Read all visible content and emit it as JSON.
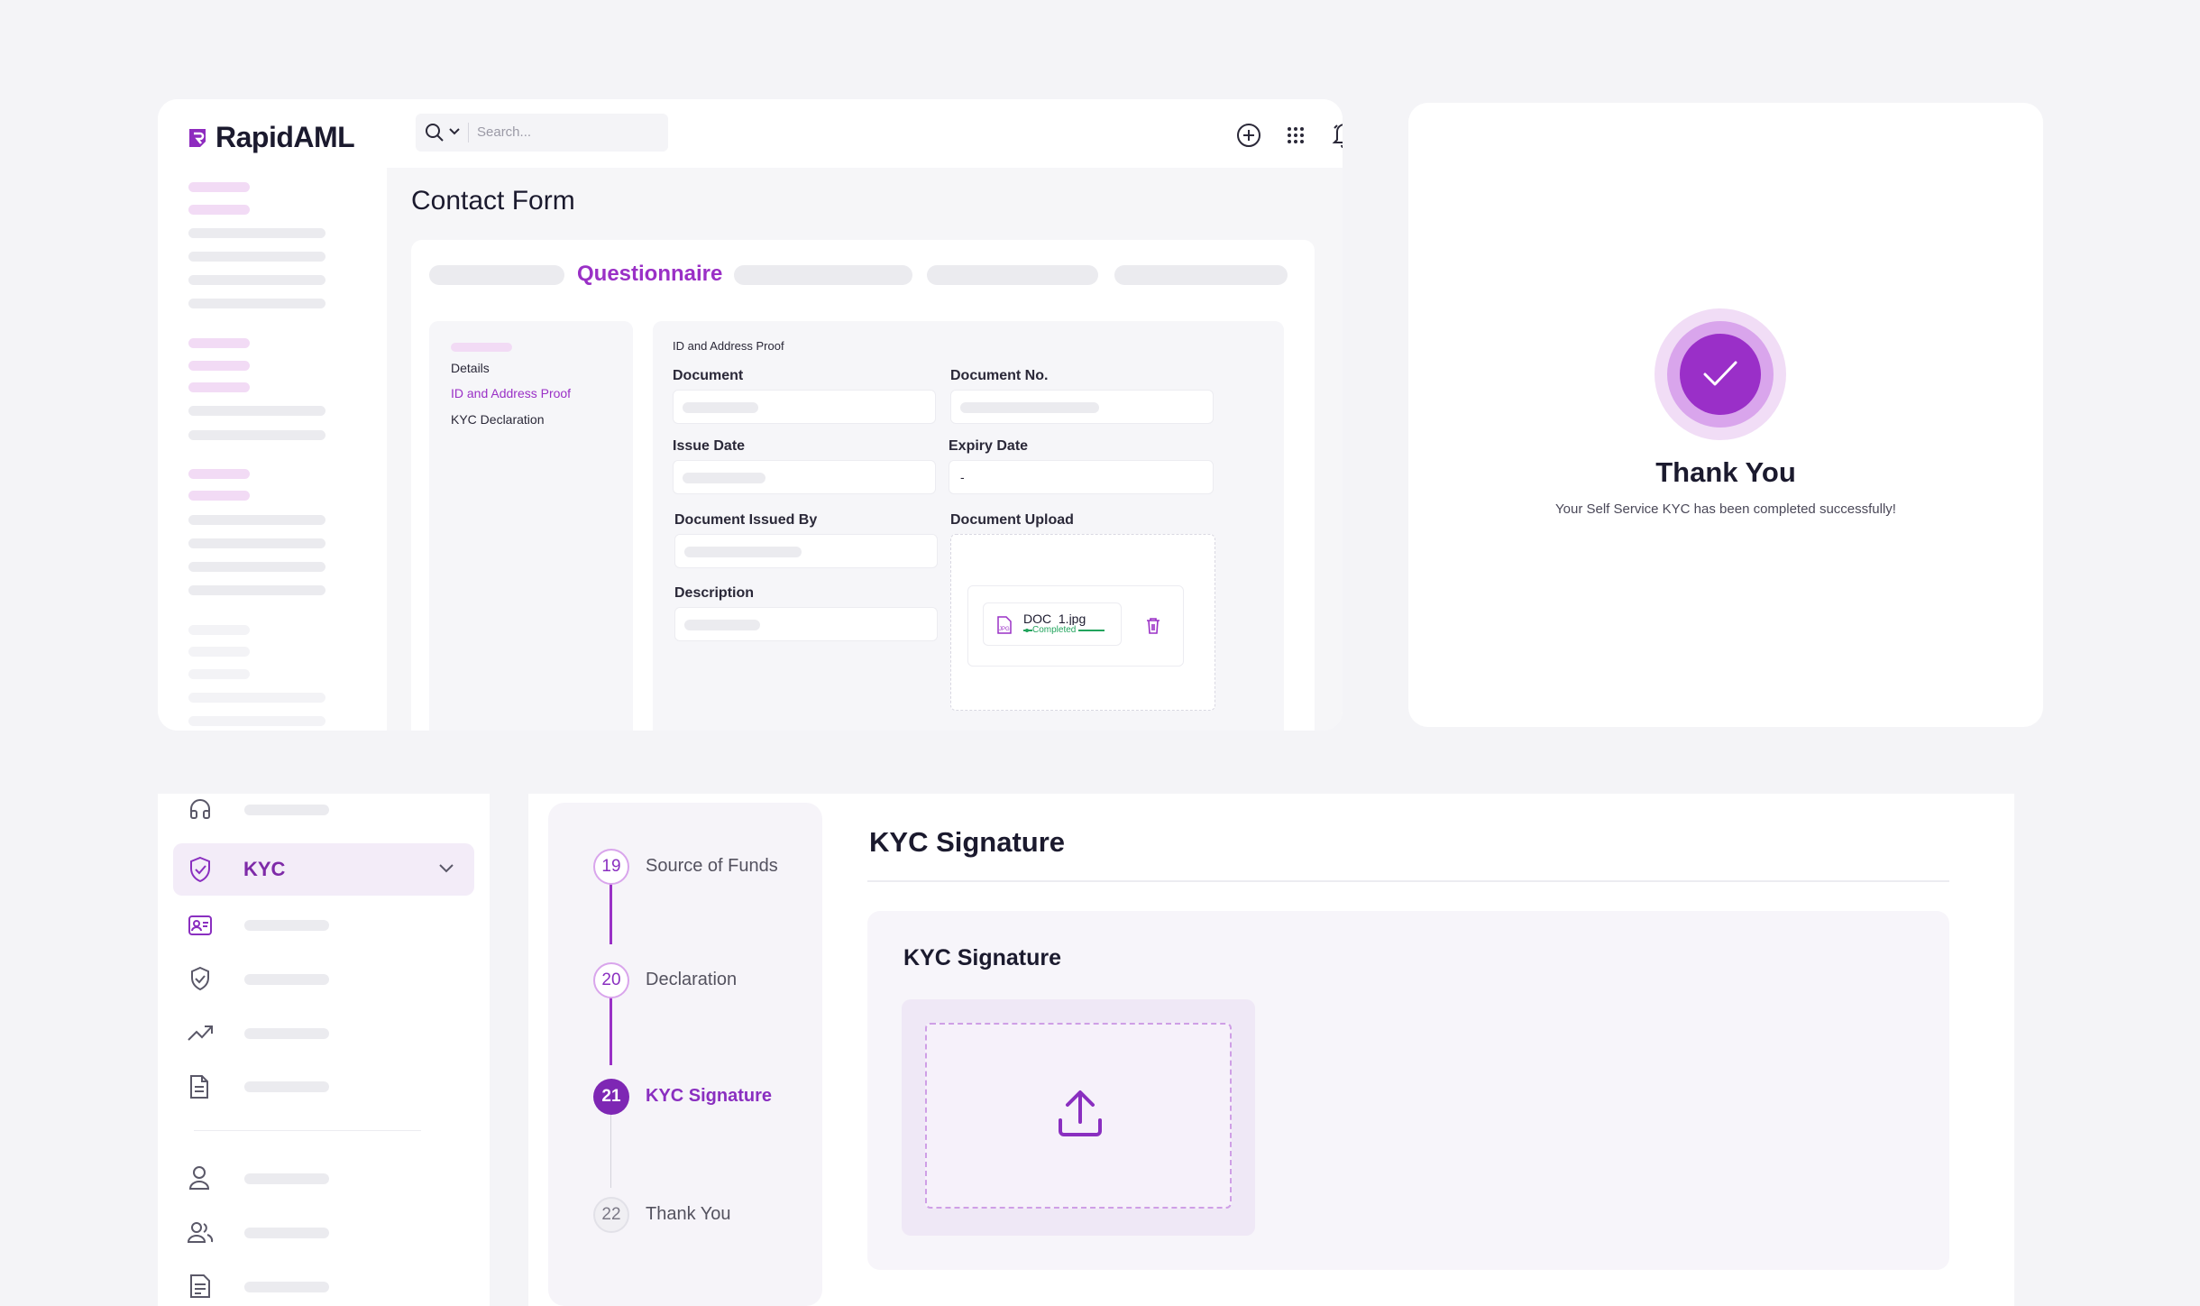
{
  "app": {
    "brand": "RapidAML",
    "search_placeholder": "Search..."
  },
  "contact_form": {
    "title": "Contact Form",
    "active_step": "Questionnaire",
    "left_nav": {
      "items": [
        {
          "label": "Details",
          "active": false
        },
        {
          "label": "ID and Address Proof",
          "active": true
        },
        {
          "label": "KYC Declaration",
          "active": false
        }
      ]
    },
    "section_title": "ID and Address Proof",
    "fields": {
      "document": "Document",
      "document_no": "Document No.",
      "issue_date": "Issue Date",
      "expiry_date": "Expiry Date",
      "expiry_value": "-",
      "issued_by": "Document Issued By",
      "document_upload": "Document Upload",
      "description": "Description"
    },
    "upload_file": {
      "name": "DOC_1.jpg",
      "status": "Completed",
      "type_label": "JPG",
      "progress": 1.0
    }
  },
  "thank_you": {
    "title": "Thank You",
    "message": "Your Self Service KYC has been completed successfully!"
  },
  "sidebar_bottom": {
    "active_item": "KYC"
  },
  "kyc_steps": [
    {
      "number": "19",
      "label": "Source of Funds",
      "state": "done"
    },
    {
      "number": "20",
      "label": "Declaration",
      "state": "done"
    },
    {
      "number": "21",
      "label": "KYC Signature",
      "state": "active"
    },
    {
      "number": "22",
      "label": "Thank You",
      "state": "pending"
    }
  ],
  "kyc_signature": {
    "title": "KYC Signature",
    "card_title": "KYC Signature"
  },
  "colors": {
    "accent": "#9a30c6",
    "accent_dark": "#7e2aa8",
    "success": "#22a45d"
  },
  "icons": [
    "search-icon",
    "chevron-down-icon",
    "plus-circle-icon",
    "grid-icon",
    "bell-icon",
    "check-icon",
    "trash-icon",
    "upload-icon",
    "shield-check-icon",
    "id-card-icon",
    "trend-icon",
    "document-icon",
    "user-icon",
    "users-icon",
    "headset-icon",
    "report-icon"
  ]
}
